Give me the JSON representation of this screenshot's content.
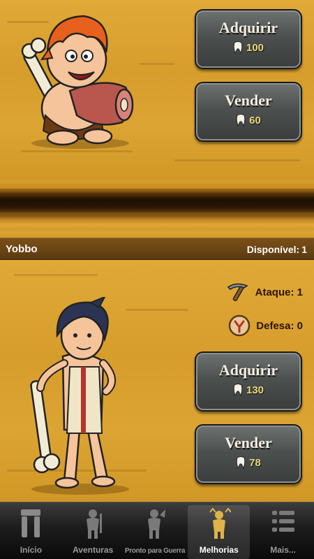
{
  "item_top": {
    "buy_button": {
      "label": "Adquirir",
      "price": "100"
    },
    "sell_button": {
      "label": "Vender",
      "price": "60"
    }
  },
  "info_bar": {
    "name": "Yobbo",
    "available_label": "Disponível:",
    "available_value": "1"
  },
  "item_bottom": {
    "attack": {
      "label": "Ataque:",
      "value": "1",
      "icon": "pickaxe-icon"
    },
    "defense": {
      "label": "Defesa:",
      "value": "0",
      "icon": "shield-icon"
    },
    "buy_button": {
      "label": "Adquirir",
      "price": "130"
    },
    "sell_button": {
      "label": "Vender",
      "price": "78"
    }
  },
  "tabbar": {
    "tabs": [
      {
        "label": "Início",
        "icon": "stone-arch-icon"
      },
      {
        "label": "Aventuras",
        "icon": "caveman-silhouette-icon"
      },
      {
        "label": "Pronto para Guerra",
        "icon": "warrior-silhouette-icon"
      },
      {
        "label": "Melhorias",
        "icon": "upgrade-caveman-icon"
      },
      {
        "label": "Mais...",
        "icon": "more-list-icon"
      }
    ],
    "active_index": 3
  },
  "colors": {
    "sand": "#d9a02e",
    "info_bar": "#6b4514",
    "button_stone": "#4c504f",
    "price_text": "#ecd87a",
    "tab_active_label": "#ffffff",
    "tab_inactive_label": "#999999"
  }
}
